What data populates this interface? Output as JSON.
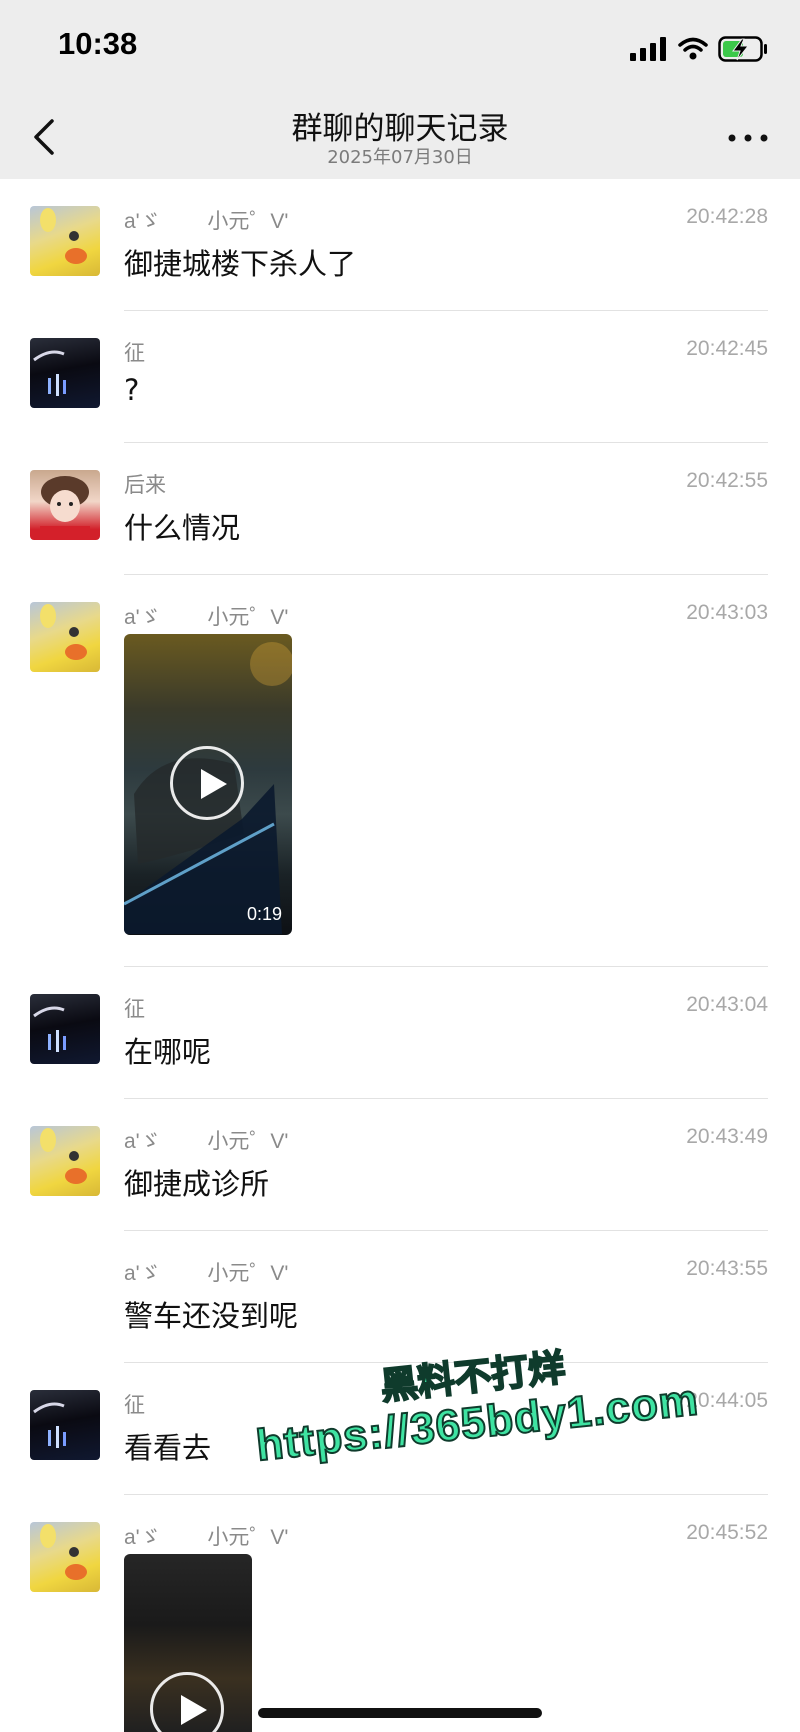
{
  "status_bar": {
    "time": "10:38"
  },
  "nav": {
    "title": "群聊的聊天记录",
    "subtitle": "2025年07月30日"
  },
  "messages": [
    {
      "sender": "a'ゞ        小元゜V'",
      "time": "20:42:28",
      "text": "御捷城楼下杀人了",
      "avatar": "duck-avatar"
    },
    {
      "sender": "征",
      "time": "20:42:45",
      "text": "?",
      "avatar": "dark-avatar"
    },
    {
      "sender": "后来",
      "time": "20:42:55",
      "text": "什么情况",
      "avatar": "girl-avatar"
    },
    {
      "sender": "a'ゞ        小元゜V'",
      "time": "20:43:03",
      "video_duration": "0:19",
      "avatar": "duck-avatar"
    },
    {
      "sender": "征",
      "time": "20:43:04",
      "text": "在哪呢",
      "avatar": "dark-avatar"
    },
    {
      "sender": "a'ゞ        小元゜V'",
      "time": "20:43:49",
      "text": "御捷成诊所",
      "avatar": "duck-avatar"
    },
    {
      "sender": "a'ゞ        小元゜V'",
      "time": "20:43:55",
      "text": "警车还没到呢"
    },
    {
      "sender": "征",
      "time": "20:44:05",
      "text": "看看去",
      "avatar": "dark-avatar"
    },
    {
      "sender": "a'ゞ        小元゜V'",
      "time": "20:45:52",
      "avatar": "duck-avatar"
    }
  ],
  "watermark": {
    "line1": "黑料不打烊",
    "line2": "https://365bdy1.com"
  },
  "colors": {
    "header_bg": "#ededed",
    "timestamp": "#a8a8a8",
    "watermark": "#3fe3a2"
  }
}
